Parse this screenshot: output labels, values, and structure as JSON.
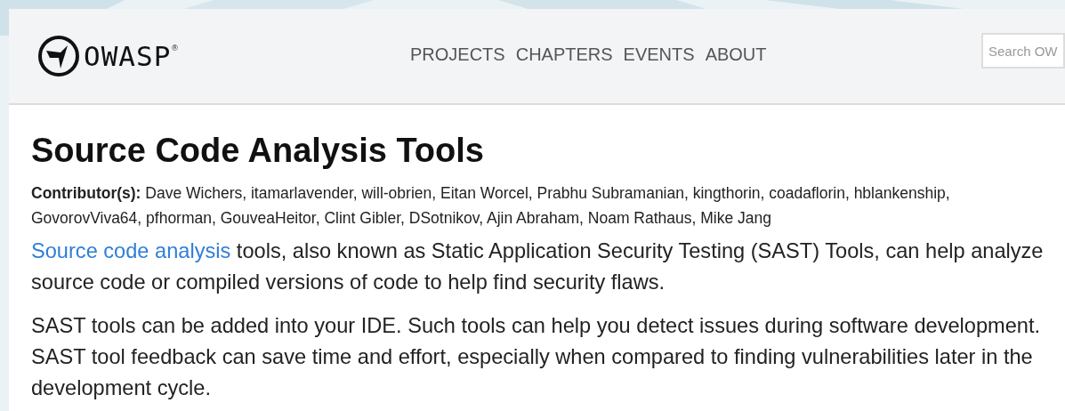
{
  "header": {
    "logo": {
      "name": "OWASP",
      "mark": "®"
    },
    "nav": [
      "PROJECTS",
      "CHAPTERS",
      "EVENTS",
      "ABOUT"
    ],
    "search": {
      "placeholder": "Search OW"
    }
  },
  "article": {
    "title": "Source Code Analysis Tools",
    "contributors": {
      "label": "Contributor(s):",
      "names": "Dave Wichers, itamarlavender, will-obrien, Eitan Worcel, Prabhu Subramanian, kingthorin, coadaflorin, hblankenship, GovorovViva64, pfhorman, GouveaHeitor, Clint Gibler, DSotnikov, Ajin Abraham, Noam Rathaus, Mike Jang"
    },
    "paragraphs": [
      {
        "link": "Source code analysis",
        "text": " tools, also known as Static Application Security Testing (SAST) Tools, can help analyze source code or compiled versions of code to help find security flaws."
      },
      {
        "text": "SAST tools can be added into your IDE. Such tools can help you detect issues during software development. SAST tool feedback can save time and effort, especially when compared to finding vulnerabilities later in the development cycle."
      }
    ]
  }
}
